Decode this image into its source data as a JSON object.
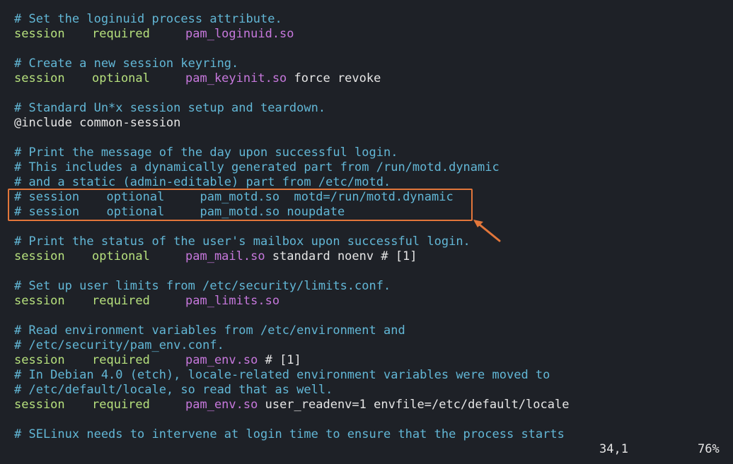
{
  "lines": [
    {
      "type": "comment",
      "text": "# Set the loginuid process attribute."
    },
    {
      "type": "directive",
      "kw": "session",
      "ctrl": "required",
      "mod": "pam_loginuid.so",
      "args": ""
    },
    {
      "type": "blank"
    },
    {
      "type": "comment",
      "text": "# Create a new session keyring."
    },
    {
      "type": "directive",
      "kw": "session",
      "ctrl": "optional",
      "mod": "pam_keyinit.so",
      "args": " force revoke"
    },
    {
      "type": "blank"
    },
    {
      "type": "comment",
      "text": "# Standard Un*x session setup and teardown."
    },
    {
      "type": "include",
      "text": "@include common-session"
    },
    {
      "type": "blank"
    },
    {
      "type": "comment",
      "text": "# Print the message of the day upon successful login."
    },
    {
      "type": "comment",
      "text": "# This includes a dynamically generated part from /run/motd.dynamic"
    },
    {
      "type": "comment",
      "text": "# and a static (admin-editable) part from /etc/motd."
    },
    {
      "type": "commented_directive",
      "prefix": "# ",
      "kw": "session",
      "ctrl": "optional",
      "mod": "pam_motd.so",
      "args": "  motd=/run/motd.dynamic"
    },
    {
      "type": "commented_directive",
      "prefix": "# ",
      "kw": "session",
      "ctrl": "optional",
      "mod": "pam_motd.so",
      "args": " noupdate"
    },
    {
      "type": "blank"
    },
    {
      "type": "comment",
      "text": "# Print the status of the user's mailbox upon successful login."
    },
    {
      "type": "directive",
      "kw": "session",
      "ctrl": "optional",
      "mod": "pam_mail.so",
      "args": " standard noenv # [1]"
    },
    {
      "type": "blank"
    },
    {
      "type": "comment",
      "text": "# Set up user limits from /etc/security/limits.conf."
    },
    {
      "type": "directive",
      "kw": "session",
      "ctrl": "required",
      "mod": "pam_limits.so",
      "args": ""
    },
    {
      "type": "blank"
    },
    {
      "type": "comment",
      "text": "# Read environment variables from /etc/environment and"
    },
    {
      "type": "comment",
      "text": "# /etc/security/pam_env.conf."
    },
    {
      "type": "directive",
      "kw": "session",
      "ctrl": "required",
      "mod": "pam_env.so",
      "args": " # [1]"
    },
    {
      "type": "comment",
      "text": "# In Debian 4.0 (etch), locale-related environment variables were moved to"
    },
    {
      "type": "comment",
      "text": "# /etc/default/locale, so read that as well."
    },
    {
      "type": "directive",
      "kw": "session",
      "ctrl": "required",
      "mod": "pam_env.so",
      "args": " user_readenv=1 envfile=/etc/default/locale"
    },
    {
      "type": "blank"
    },
    {
      "type": "comment",
      "text": "# SELinux needs to intervene at login time to ensure that the process starts"
    }
  ],
  "status": {
    "position": "34,1",
    "percent": "76%"
  },
  "colors": {
    "background": "#1e2127",
    "comment": "#62b7d6",
    "keyword": "#b6e07d",
    "module": "#c778dd",
    "text": "#e6e6e6",
    "annotation": "#e2763a"
  }
}
